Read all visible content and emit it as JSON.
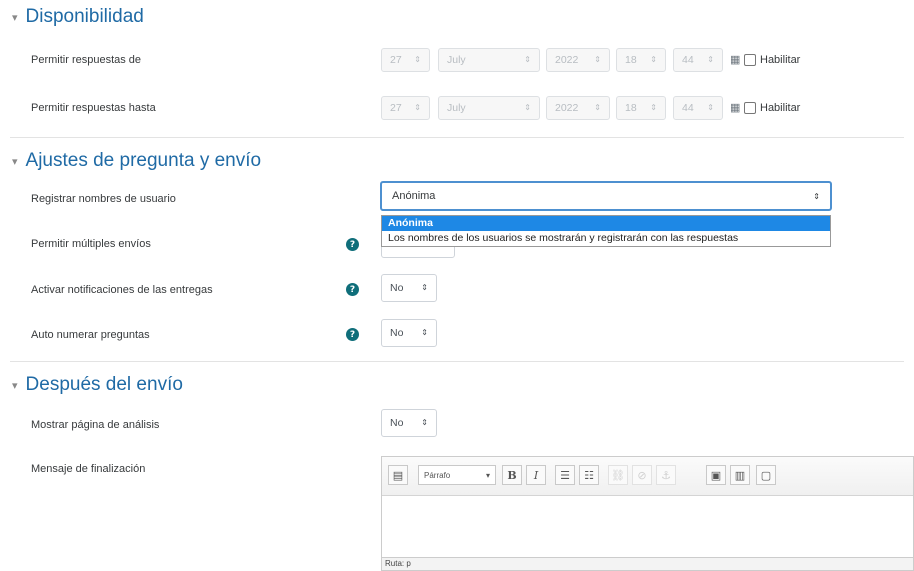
{
  "sections": {
    "availability": {
      "title": "Disponibilidad"
    },
    "question_settings": {
      "title": "Ajustes de pregunta y envío"
    },
    "after_submit": {
      "title": "Después del envío"
    }
  },
  "availability": {
    "from": {
      "label": "Permitir respuestas de",
      "day": "27",
      "month": "July",
      "year": "2022",
      "hour": "18",
      "minute": "44",
      "enable_label": "Habilitar"
    },
    "until": {
      "label": "Permitir respuestas hasta",
      "day": "27",
      "month": "July",
      "year": "2022",
      "hour": "18",
      "minute": "44",
      "enable_label": "Habilitar"
    }
  },
  "question_settings": {
    "record_usernames": {
      "label": "Registrar nombres de usuario",
      "value": "Anónima",
      "options": [
        "Anónima",
        "Los nombres de los usuarios se mostrarán y registrarán con las respuestas"
      ]
    },
    "multiple_submissions": {
      "label": "Permitir múltiples envíos"
    },
    "notifications": {
      "label": "Activar notificaciones de las entregas",
      "value": "No"
    },
    "auto_number": {
      "label": "Auto numerar preguntas",
      "value": "No"
    }
  },
  "after_submit": {
    "analysis_page": {
      "label": "Mostrar página de análisis",
      "value": "No"
    },
    "completion_message": {
      "label": "Mensaje de finalización"
    }
  },
  "editor": {
    "format": "Párrafo",
    "bold": "B",
    "italic": "I",
    "path": "Ruta: p"
  },
  "icons": {
    "caret": "▾",
    "select_arrow": "⇕",
    "help": "?"
  },
  "colors": {
    "section_title": "#1f6aa5",
    "focus_border": "#4d90d0",
    "selected_option": "#1e88e5",
    "help_icon": "#0f6e7a"
  }
}
